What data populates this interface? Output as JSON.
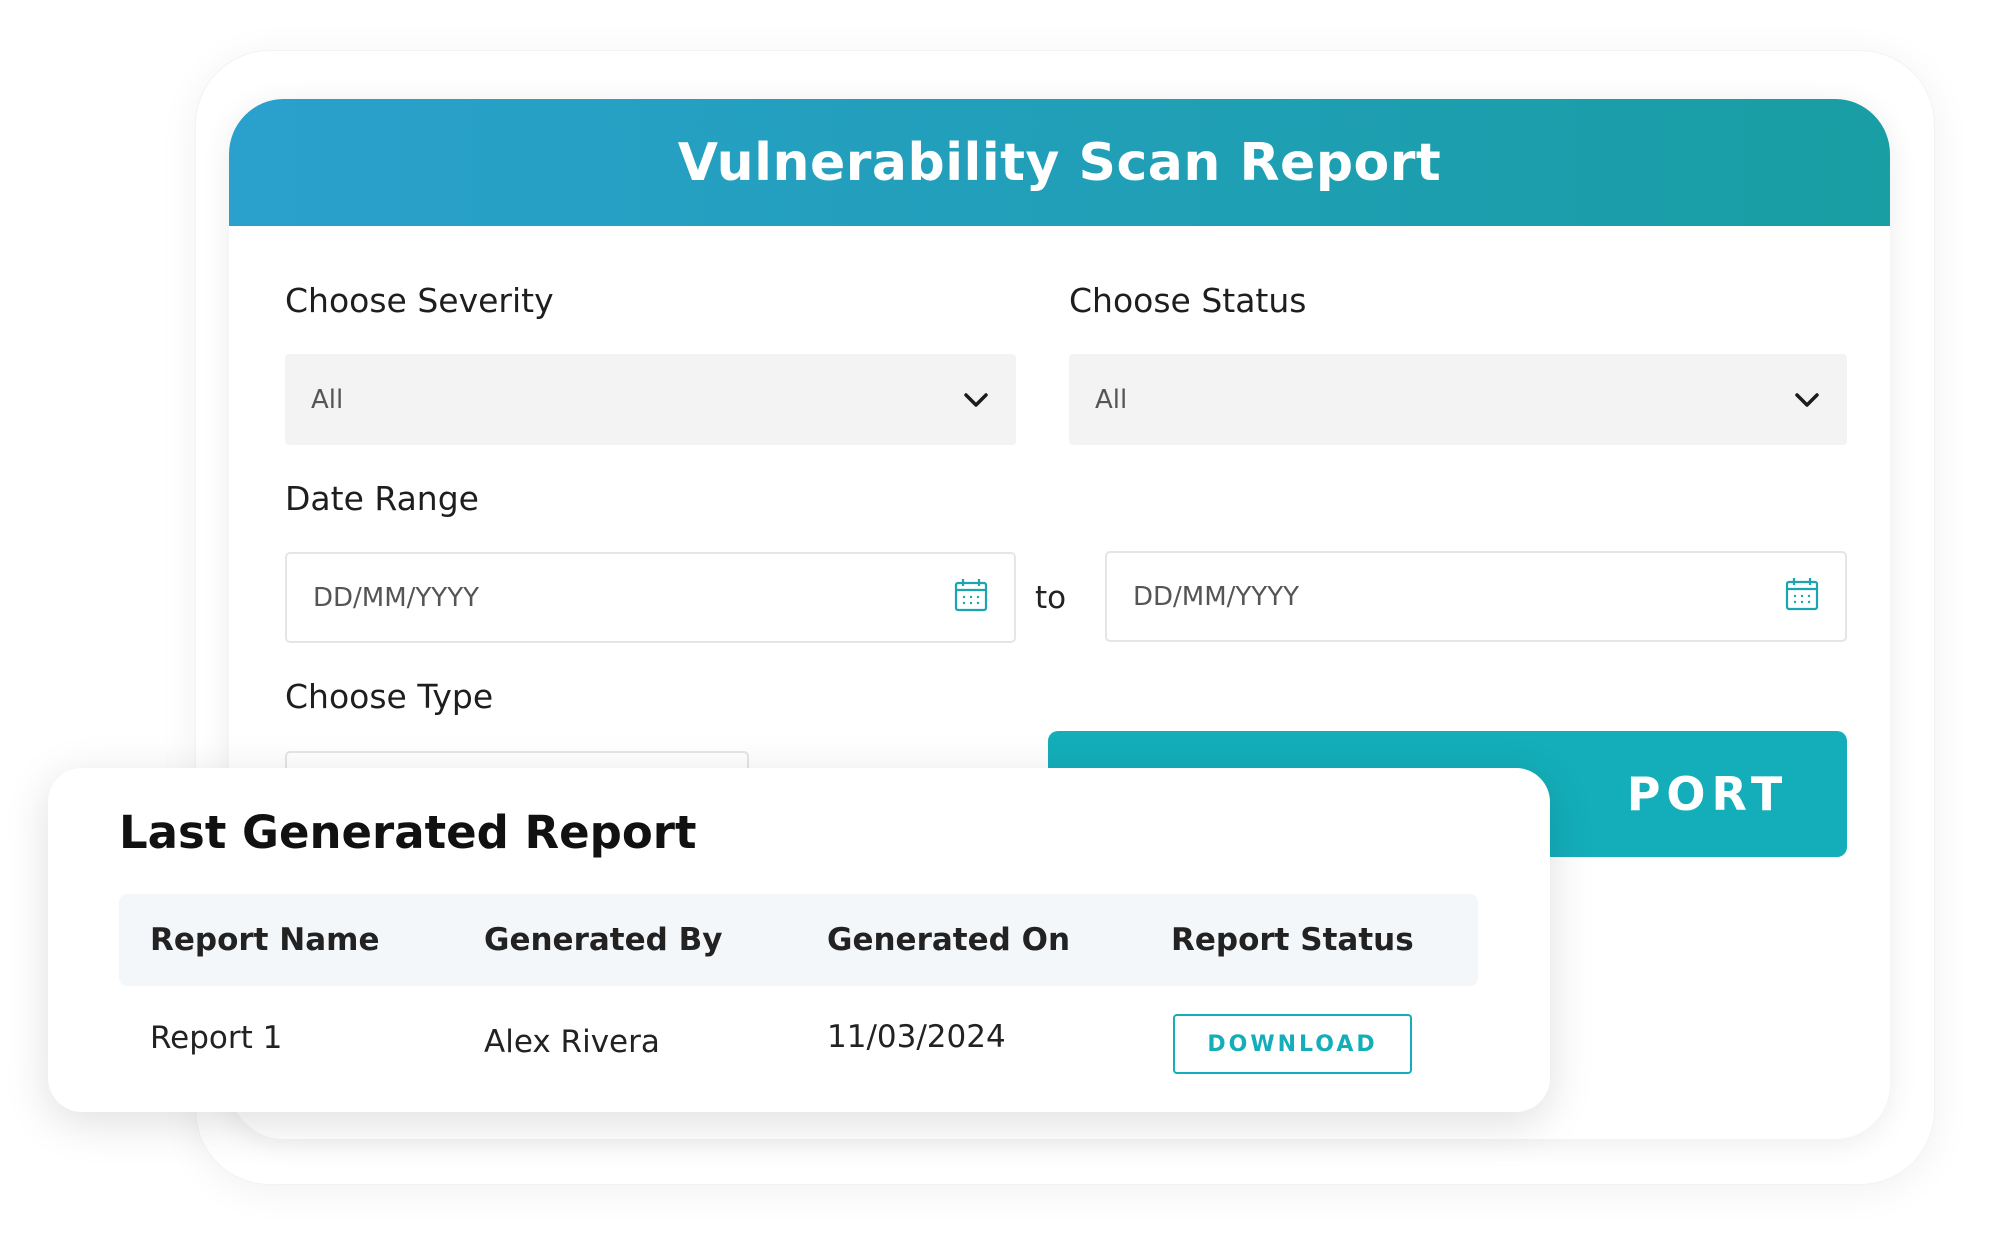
{
  "header": {
    "title": "Vulnerability Scan Report"
  },
  "form": {
    "severity": {
      "label": "Choose Severity",
      "value": "All",
      "icon": "chevron-down-icon"
    },
    "status": {
      "label": "Choose Status",
      "value": "All",
      "icon": "chevron-down-icon"
    },
    "date_range": {
      "label": "Date Range",
      "from_placeholder": "DD/MM/YYYY",
      "to_text": "to",
      "to_placeholder": "DD/MM/YYYY",
      "icon": "calendar-icon"
    },
    "type": {
      "label": "Choose Type"
    },
    "generate_button": {
      "visible_label": "PORT"
    }
  },
  "last_report": {
    "title": "Last Generated Report",
    "columns": [
      "Report Name",
      "Generated By",
      "Generated On",
      "Report Status"
    ],
    "rows": [
      {
        "name": "Report 1",
        "generated_by": "Alex Rivera",
        "generated_on": "11/03/2024",
        "action": "DOWNLOAD"
      }
    ]
  },
  "colors": {
    "header_gradient_start": "#2aa0cd",
    "header_gradient_end": "#189ea3",
    "accent": "#13aeb9",
    "icon_teal": "#1aa5b0"
  }
}
